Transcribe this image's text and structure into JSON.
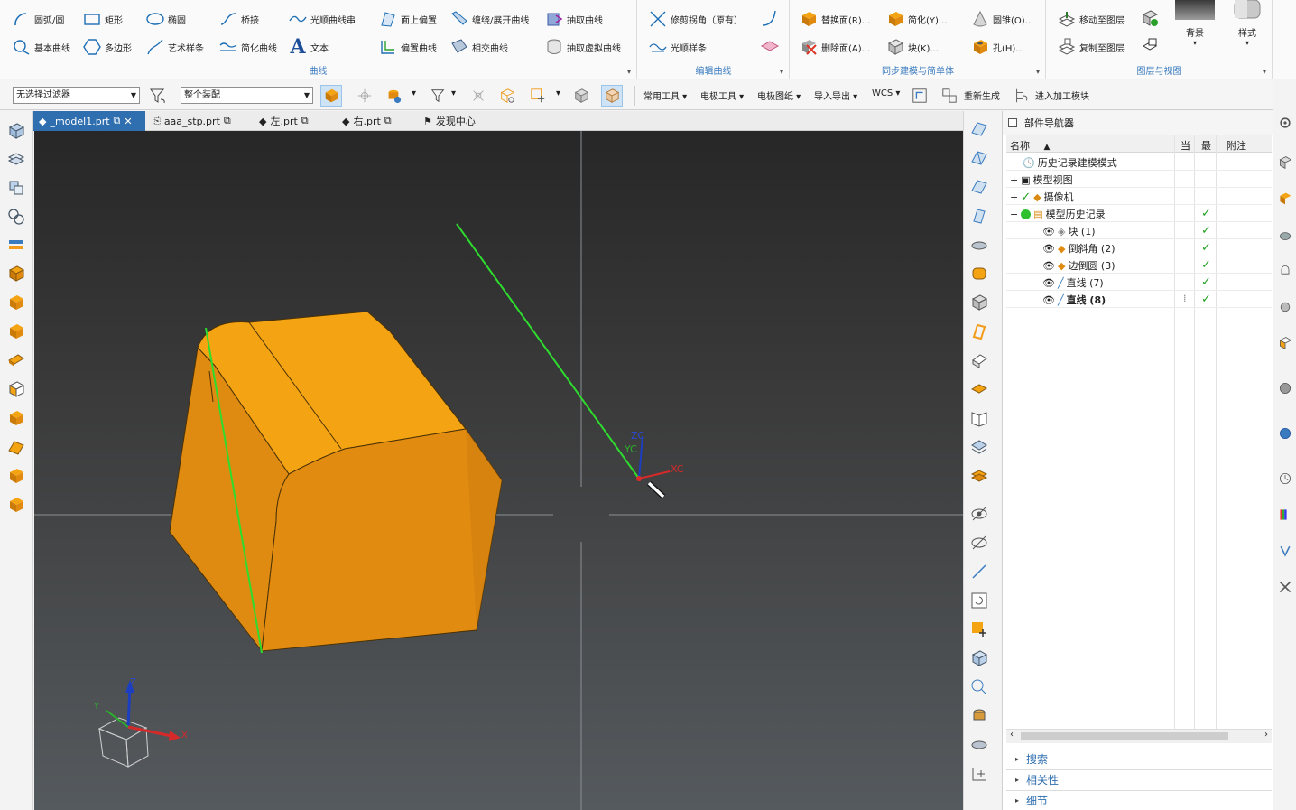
{
  "ribbon": {
    "groups": [
      {
        "label": "曲线",
        "items": [
          {
            "label": "圆弧/圆",
            "icon": "arc-circle-icon"
          },
          {
            "label": "矩形",
            "icon": "rectangle-icon"
          },
          {
            "label": "椭圆",
            "icon": "ellipse-icon"
          },
          {
            "label": "桥接",
            "icon": "bridge-curve-icon"
          },
          {
            "label": "光顺曲线串",
            "icon": "smooth-curve-string-icon"
          },
          {
            "label": "面上偏置",
            "icon": "offset-on-face-icon"
          },
          {
            "label": "缠绕/展开曲线",
            "icon": "wrap-unwrap-icon"
          },
          {
            "label": "抽取曲线",
            "icon": "extract-curve-icon"
          },
          {
            "label": "基本曲线",
            "icon": "basic-curves-icon"
          },
          {
            "label": "多边形",
            "icon": "polygon-icon"
          },
          {
            "label": "艺术样条",
            "icon": "studio-spline-icon"
          },
          {
            "label": "简化曲线",
            "icon": "simplify-curve-icon"
          },
          {
            "label": "文本",
            "icon": "text-icon"
          },
          {
            "label": "偏置曲线",
            "icon": "offset-curve-icon"
          },
          {
            "label": "相交曲线",
            "icon": "intersect-curve-icon"
          },
          {
            "label": "抽取虚拟曲线",
            "icon": "extract-virtual-curve-icon"
          }
        ]
      },
      {
        "label": "编辑曲线",
        "items": [
          {
            "label": "修剪拐角（原有）",
            "icon": "trim-corner-icon"
          },
          {
            "label": "光顺样条",
            "icon": "smooth-spline-icon"
          }
        ]
      },
      {
        "label": "同步建模与简单体",
        "items": [
          {
            "label": "替换面(R)...",
            "icon": "replace-face-icon"
          },
          {
            "label": "简化(Y)...",
            "icon": "simplify-icon"
          },
          {
            "label": "圆锥(O)...",
            "icon": "cone-icon"
          },
          {
            "label": "删除面(A)...",
            "icon": "delete-face-icon"
          },
          {
            "label": "块(K)...",
            "icon": "block-icon"
          },
          {
            "label": "孔(H)...",
            "icon": "hole-icon"
          }
        ]
      },
      {
        "label": "图层与视图",
        "items": [
          {
            "label": "移动至图层",
            "icon": "move-to-layer-icon"
          },
          {
            "label": "复制至图层",
            "icon": "copy-to-layer-icon"
          },
          {
            "label": "背景",
            "icon": "background-icon"
          },
          {
            "label": "样式",
            "icon": "style-icon"
          }
        ]
      }
    ]
  },
  "toolbar2": {
    "filter_value": "无选择过滤器",
    "assembly_value": "整个装配",
    "menus": [
      "常用工具",
      "电极工具",
      "电极图纸",
      "导入导出",
      "WCS"
    ],
    "regenerate_label": "重新生成",
    "enter_machining_label": "进入加工模块"
  },
  "tabs": [
    {
      "label": "_model1.prt",
      "active": true
    },
    {
      "label": "aaa_stp.prt",
      "active": false
    },
    {
      "label": "左.prt",
      "active": false
    },
    {
      "label": "右.prt",
      "active": false
    },
    {
      "label": "发现中心",
      "active": false
    }
  ],
  "viewport": {
    "wcs_labels": {
      "zc": "ZC",
      "yc": "YC",
      "xc": "XC"
    },
    "triad_labels": {
      "z": "Z",
      "y": "Y",
      "x": "X"
    },
    "colors": {
      "solid_top": "#f4a313",
      "solid_side": "#e08a10",
      "solid_dark": "#d17f0f",
      "line": "#2edc2e"
    }
  },
  "navigator": {
    "title": "部件导航器",
    "columns": {
      "name": "名称",
      "current": "当",
      "latest": "最",
      "note": "附注"
    },
    "rows": [
      {
        "label": "历史记录建模模式",
        "icon": "clock-icon",
        "indent": 0,
        "latest_check": false
      },
      {
        "label": "模型视图",
        "icon": "model-views-icon",
        "indent": 0,
        "latest_check": false
      },
      {
        "label": "摄像机",
        "icon": "camera-icon",
        "indent": 0,
        "latest_check": false
      },
      {
        "label": "模型历史记录",
        "icon": "history-icon",
        "indent": 0,
        "latest_check": true
      },
      {
        "label": "块 (1)",
        "icon": "block-feature-icon",
        "indent": 1,
        "latest_check": true
      },
      {
        "label": "倒斜角 (2)",
        "icon": "chamfer-feature-icon",
        "indent": 1,
        "latest_check": true
      },
      {
        "label": "边倒圆 (3)",
        "icon": "blend-feature-icon",
        "indent": 1,
        "latest_check": true
      },
      {
        "label": "直线 (7)",
        "icon": "line-feature-icon",
        "indent": 1,
        "latest_check": true
      },
      {
        "label": "直线 (8)",
        "icon": "line-feature-icon",
        "indent": 1,
        "latest_check": true,
        "bold": true
      }
    ],
    "sections": [
      "搜索",
      "相关性",
      "细节"
    ]
  }
}
